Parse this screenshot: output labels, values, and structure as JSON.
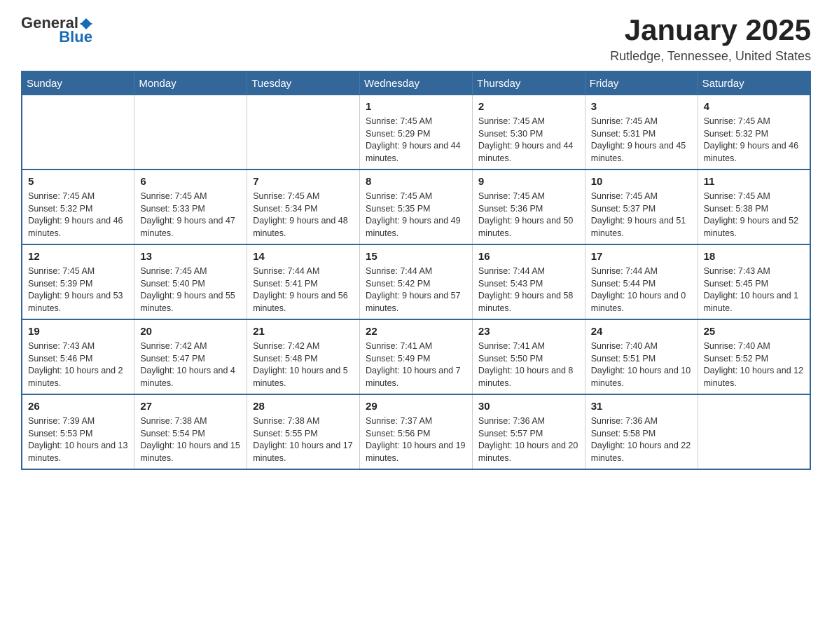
{
  "logo": {
    "text_general": "General",
    "text_blue": "Blue"
  },
  "title": "January 2025",
  "location": "Rutledge, Tennessee, United States",
  "days_of_week": [
    "Sunday",
    "Monday",
    "Tuesday",
    "Wednesday",
    "Thursday",
    "Friday",
    "Saturday"
  ],
  "weeks": [
    [
      {
        "day": "",
        "info": ""
      },
      {
        "day": "",
        "info": ""
      },
      {
        "day": "",
        "info": ""
      },
      {
        "day": "1",
        "info": "Sunrise: 7:45 AM\nSunset: 5:29 PM\nDaylight: 9 hours and 44 minutes."
      },
      {
        "day": "2",
        "info": "Sunrise: 7:45 AM\nSunset: 5:30 PM\nDaylight: 9 hours and 44 minutes."
      },
      {
        "day": "3",
        "info": "Sunrise: 7:45 AM\nSunset: 5:31 PM\nDaylight: 9 hours and 45 minutes."
      },
      {
        "day": "4",
        "info": "Sunrise: 7:45 AM\nSunset: 5:32 PM\nDaylight: 9 hours and 46 minutes."
      }
    ],
    [
      {
        "day": "5",
        "info": "Sunrise: 7:45 AM\nSunset: 5:32 PM\nDaylight: 9 hours and 46 minutes."
      },
      {
        "day": "6",
        "info": "Sunrise: 7:45 AM\nSunset: 5:33 PM\nDaylight: 9 hours and 47 minutes."
      },
      {
        "day": "7",
        "info": "Sunrise: 7:45 AM\nSunset: 5:34 PM\nDaylight: 9 hours and 48 minutes."
      },
      {
        "day": "8",
        "info": "Sunrise: 7:45 AM\nSunset: 5:35 PM\nDaylight: 9 hours and 49 minutes."
      },
      {
        "day": "9",
        "info": "Sunrise: 7:45 AM\nSunset: 5:36 PM\nDaylight: 9 hours and 50 minutes."
      },
      {
        "day": "10",
        "info": "Sunrise: 7:45 AM\nSunset: 5:37 PM\nDaylight: 9 hours and 51 minutes."
      },
      {
        "day": "11",
        "info": "Sunrise: 7:45 AM\nSunset: 5:38 PM\nDaylight: 9 hours and 52 minutes."
      }
    ],
    [
      {
        "day": "12",
        "info": "Sunrise: 7:45 AM\nSunset: 5:39 PM\nDaylight: 9 hours and 53 minutes."
      },
      {
        "day": "13",
        "info": "Sunrise: 7:45 AM\nSunset: 5:40 PM\nDaylight: 9 hours and 55 minutes."
      },
      {
        "day": "14",
        "info": "Sunrise: 7:44 AM\nSunset: 5:41 PM\nDaylight: 9 hours and 56 minutes."
      },
      {
        "day": "15",
        "info": "Sunrise: 7:44 AM\nSunset: 5:42 PM\nDaylight: 9 hours and 57 minutes."
      },
      {
        "day": "16",
        "info": "Sunrise: 7:44 AM\nSunset: 5:43 PM\nDaylight: 9 hours and 58 minutes."
      },
      {
        "day": "17",
        "info": "Sunrise: 7:44 AM\nSunset: 5:44 PM\nDaylight: 10 hours and 0 minutes."
      },
      {
        "day": "18",
        "info": "Sunrise: 7:43 AM\nSunset: 5:45 PM\nDaylight: 10 hours and 1 minute."
      }
    ],
    [
      {
        "day": "19",
        "info": "Sunrise: 7:43 AM\nSunset: 5:46 PM\nDaylight: 10 hours and 2 minutes."
      },
      {
        "day": "20",
        "info": "Sunrise: 7:42 AM\nSunset: 5:47 PM\nDaylight: 10 hours and 4 minutes."
      },
      {
        "day": "21",
        "info": "Sunrise: 7:42 AM\nSunset: 5:48 PM\nDaylight: 10 hours and 5 minutes."
      },
      {
        "day": "22",
        "info": "Sunrise: 7:41 AM\nSunset: 5:49 PM\nDaylight: 10 hours and 7 minutes."
      },
      {
        "day": "23",
        "info": "Sunrise: 7:41 AM\nSunset: 5:50 PM\nDaylight: 10 hours and 8 minutes."
      },
      {
        "day": "24",
        "info": "Sunrise: 7:40 AM\nSunset: 5:51 PM\nDaylight: 10 hours and 10 minutes."
      },
      {
        "day": "25",
        "info": "Sunrise: 7:40 AM\nSunset: 5:52 PM\nDaylight: 10 hours and 12 minutes."
      }
    ],
    [
      {
        "day": "26",
        "info": "Sunrise: 7:39 AM\nSunset: 5:53 PM\nDaylight: 10 hours and 13 minutes."
      },
      {
        "day": "27",
        "info": "Sunrise: 7:38 AM\nSunset: 5:54 PM\nDaylight: 10 hours and 15 minutes."
      },
      {
        "day": "28",
        "info": "Sunrise: 7:38 AM\nSunset: 5:55 PM\nDaylight: 10 hours and 17 minutes."
      },
      {
        "day": "29",
        "info": "Sunrise: 7:37 AM\nSunset: 5:56 PM\nDaylight: 10 hours and 19 minutes."
      },
      {
        "day": "30",
        "info": "Sunrise: 7:36 AM\nSunset: 5:57 PM\nDaylight: 10 hours and 20 minutes."
      },
      {
        "day": "31",
        "info": "Sunrise: 7:36 AM\nSunset: 5:58 PM\nDaylight: 10 hours and 22 minutes."
      },
      {
        "day": "",
        "info": ""
      }
    ]
  ]
}
